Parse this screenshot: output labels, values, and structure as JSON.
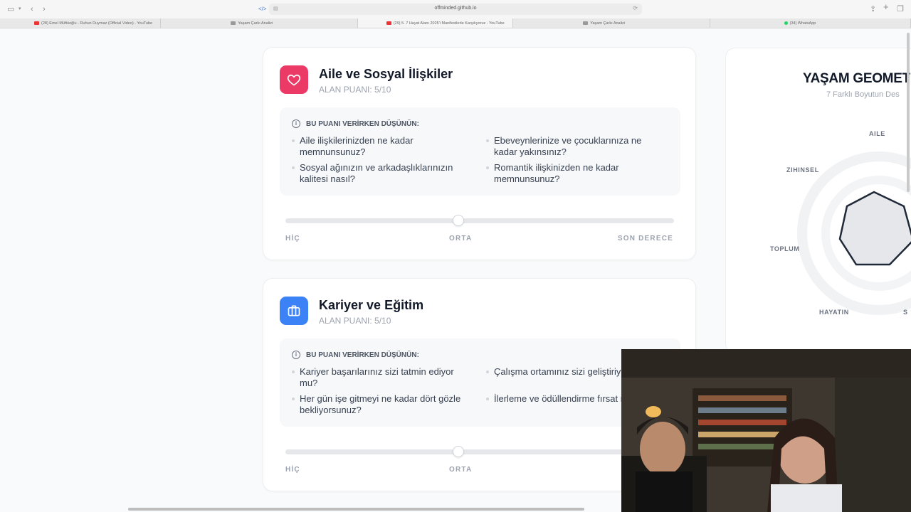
{
  "browser": {
    "url": "offminded.github.io",
    "tabs": [
      {
        "label": "(28) Emel Müftüoğlu - Ruhun Duymaz (Official Video) - YouTube",
        "icon": "youtube-icon",
        "active": false
      },
      {
        "label": "Yaşam Çarkı Analizi",
        "icon": "page-icon",
        "active": false
      },
      {
        "label": "(29) 5. 7 Hayat Alanı 2025'i Manifestlerle Karşılıyoruz - YouTube",
        "icon": "youtube-icon",
        "active": true
      },
      {
        "label": "Yaşam Çarkı Analizi",
        "icon": "page-icon",
        "active": false
      },
      {
        "label": "(34) WhatsApp",
        "icon": "whatsapp-icon",
        "active": false
      }
    ]
  },
  "cards": [
    {
      "title": "Aile ve Sosyal İlişkiler",
      "subtitle": "ALAN PUANI: 5/10",
      "icon": "heart-icon",
      "icon_color": "#ec3a67",
      "hint_title": "BU PUANI VERİRKEN DÜŞÜNÜN:",
      "questions": [
        "Aile ilişkilerinizden ne kadar memnunsunuz?",
        "Ebeveynlerinize ve çocuklarınıza ne kadar yakınsınız?",
        "Sosyal ağınızın ve arkadaşlıklarınızın kalitesi nasıl?",
        "Romantik ilişkinizden ne kadar memnunsunuz?"
      ],
      "slider_value": 5,
      "slider_max": 10,
      "labels": {
        "low": "HİÇ",
        "mid": "ORTA",
        "high": "SON DERECE"
      }
    },
    {
      "title": "Kariyer ve Eğitim",
      "subtitle": "ALAN PUANI: 5/10",
      "icon": "briefcase-icon",
      "icon_color": "#3b82f6",
      "hint_title": "BU PUANI VERİRKEN DÜŞÜNÜN:",
      "questions": [
        "Kariyer başarılarınız sizi tatmin ediyor mu?",
        "Çalışma ortamınız sizi geliştiriy",
        "Her gün işe gitmeyi ne kadar dört gözle bekliyorsunuz?",
        "İlerleme ve ödüllendirme fırsat mı?"
      ],
      "slider_value": 5,
      "slider_max": 10,
      "labels": {
        "low": "HİÇ",
        "mid": "ORTA",
        "high": ""
      }
    }
  ],
  "geometry": {
    "title": "YAŞAM GEOMET",
    "subtitle": "7 Farklı Boyutun Des",
    "axes": [
      "AILE",
      "ZIHINSEL",
      "TOPLUM",
      "HAYATIN",
      "S"
    ]
  },
  "colors": {
    "accent_red": "#ec3a67",
    "accent_blue": "#3b82f6"
  }
}
